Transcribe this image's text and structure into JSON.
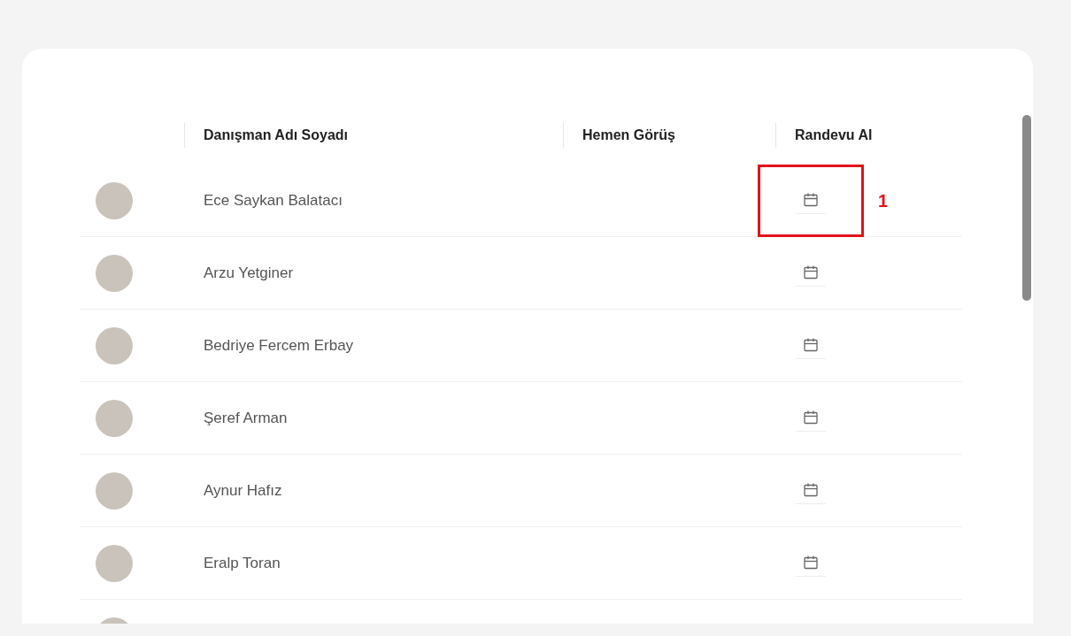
{
  "table": {
    "columns": [
      {
        "label": "Danışman Adı Soyadı"
      },
      {
        "label": "Hemen Görüş"
      },
      {
        "label": "Randevu Al"
      }
    ],
    "rows": [
      {
        "name": "Ece Saykan Balatacı",
        "highlighted": true,
        "annotation": "1"
      },
      {
        "name": "Arzu Yetginer",
        "highlighted": false
      },
      {
        "name": "Bedriye Fercem Erbay",
        "highlighted": false
      },
      {
        "name": "Şeref Arman",
        "highlighted": false
      },
      {
        "name": "Aynur Hafız",
        "highlighted": false
      },
      {
        "name": "Eralp Toran",
        "highlighted": false
      },
      {
        "highlighted": false
      }
    ]
  }
}
